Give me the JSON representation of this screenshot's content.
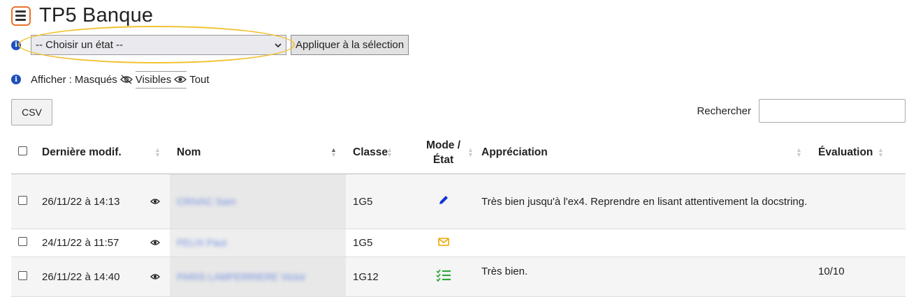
{
  "page": {
    "title": "TP5 Banque"
  },
  "bulk": {
    "select_value": "-- Choisir un état --",
    "apply_label": "Appliquer à la sélection"
  },
  "show": {
    "prefix": "Afficher :",
    "hidden": "Masqués",
    "visible": "Visibles",
    "all": "Tout",
    "active": "visible"
  },
  "toolbar": {
    "csv_label": "CSV",
    "search_label": "Rechercher",
    "search_value": ""
  },
  "table": {
    "columns": [
      "Dernière modif.",
      "Nom",
      "Classe",
      "Mode / État",
      "Appréciation",
      "Évaluation"
    ],
    "rows": [
      {
        "date": "26/11/22 à 14:13",
        "name": "CRIVAC Sam",
        "classe": "1G5",
        "state_icon": "pencil-icon",
        "appreciation": "Très bien jusqu'à l'ex4. Reprendre en lisant attentivement la docstring.",
        "evaluation": ""
      },
      {
        "date": "24/11/22 à 11:57",
        "name": "FELIX Paul",
        "classe": "1G5",
        "state_icon": "envelope-icon",
        "appreciation": "",
        "evaluation": ""
      },
      {
        "date": "26/11/22 à 14:40",
        "name": "PARIS LAMPERRIERE Victor",
        "classe": "1G12",
        "state_icon": "checklist-icon",
        "appreciation": "Très bien.",
        "evaluation": "10/10"
      }
    ]
  },
  "colors": {
    "accent_orange": "#e8742c",
    "highlight": "#f1c232",
    "info_blue": "#1d4fbd",
    "pencil_blue": "#1033d6",
    "envelope_orange": "#f0a500",
    "check_green": "#2eaa3a"
  }
}
